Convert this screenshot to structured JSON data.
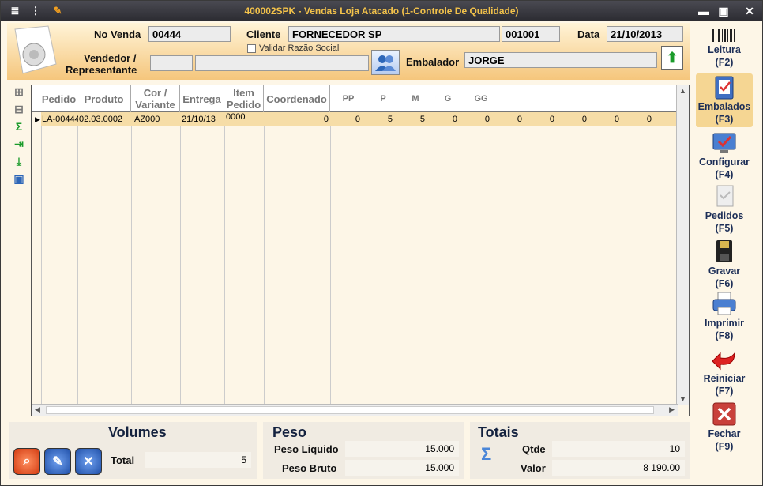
{
  "window": {
    "title": "400002SPK - Vendas Loja Atacado (1-Controle De Qualidade)"
  },
  "header": {
    "no_venda_label": "No Venda",
    "no_venda_value": "00444",
    "cliente_label": "Cliente",
    "cliente_value": "FORNECEDOR SP",
    "cliente_code": "001001",
    "data_label": "Data",
    "data_value": "21/10/2013",
    "validar_label": "Validar Razão Social",
    "vendedor_label_1": "Vendedor /",
    "vendedor_label_2": "Representante",
    "vendedor_code": "",
    "vendedor_name": "",
    "embalador_label": "Embalador",
    "embalador_value": "JORGE"
  },
  "grid": {
    "columns": [
      "Pedido",
      "Produto",
      "Cor / Variante",
      "Entrega",
      "Item Pedido",
      "Coordenado",
      "PP",
      "P",
      "M",
      "G",
      "GG"
    ],
    "rows": [
      {
        "pedido": "LA-00444",
        "produto": "02.03.0002",
        "cor": "AZ000",
        "entrega": "21/10/13",
        "item": "0000",
        "coordenado": "0",
        "sizes": [
          "0",
          "5",
          "5",
          "0",
          "0",
          "0",
          "0",
          "0",
          "0",
          "0"
        ]
      }
    ]
  },
  "sidebar": {
    "leitura": "Leitura",
    "leitura_key": "(F2)",
    "embalados": "Embalados",
    "embalados_key": "(F3)",
    "configurar": "Configurar",
    "configurar_key": "(F4)",
    "pedidos": "Pedidos",
    "pedidos_key": "(F5)",
    "gravar": "Gravar",
    "gravar_key": "(F6)",
    "imprimir": "Imprimir",
    "imprimir_key": "(F8)",
    "reiniciar": "Reiniciar",
    "reiniciar_key": "(F7)",
    "fechar": "Fechar",
    "fechar_key": "(F9)"
  },
  "volumes": {
    "title": "Volumes",
    "total_label": "Total",
    "total_value": "5"
  },
  "peso": {
    "title": "Peso",
    "liquido_label": "Peso Liquido",
    "liquido_value": "15.000",
    "bruto_label": "Peso Bruto",
    "bruto_value": "15.000"
  },
  "totais": {
    "title": "Totais",
    "qtde_label": "Qtde",
    "qtde_value": "10",
    "valor_label": "Valor",
    "valor_value": "8 190.00"
  },
  "colors": {
    "accent": "#f3c24a",
    "row_highlight": "#f6dda7",
    "sidebar_text": "#1c2e57"
  }
}
